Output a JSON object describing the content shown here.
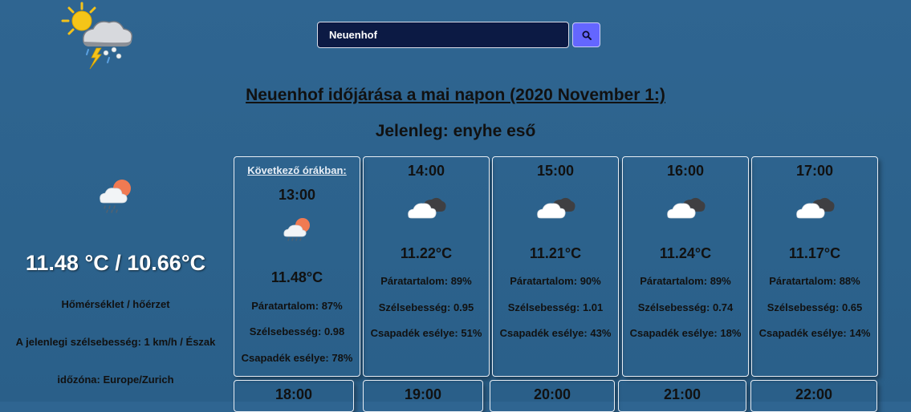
{
  "search": {
    "value": "Neuenhof",
    "button_icon": "search-icon"
  },
  "title": "Neuenhof időjárása a mai napon (2020 November 1:)",
  "current_condition": "Jelenleg: enyhe eső",
  "current": {
    "temp": "11.48 °C / 10.66°C",
    "temp_caption": "Hőmérséklet / hőérzet",
    "wind": "A jelenlegi szélsebesség: 1 km/h / Észak",
    "timezone": "időzóna: Europe/Zurich"
  },
  "labels": {
    "next_hours": "Következő órákban:",
    "humidity": "Páratartalom:",
    "wind": "Szélsebesség:",
    "precip": "Csapadék esélye:"
  },
  "hours": [
    {
      "time": "13:00",
      "temp": "11.48°C",
      "humidity": "87%",
      "wind": "0.98",
      "precip": "78%",
      "icon": "sun-cloud-rain-icon"
    },
    {
      "time": "14:00",
      "temp": "11.22°C",
      "humidity": "89%",
      "wind": "0.95",
      "precip": "51%",
      "icon": "cloud-icon"
    },
    {
      "time": "15:00",
      "temp": "11.21°C",
      "humidity": "90%",
      "wind": "1.01",
      "precip": "43%",
      "icon": "cloud-icon"
    },
    {
      "time": "16:00",
      "temp": "11.24°C",
      "humidity": "89%",
      "wind": "0.74",
      "precip": "18%",
      "icon": "cloud-icon"
    },
    {
      "time": "17:00",
      "temp": "11.17°C",
      "humidity": "88%",
      "wind": "0.65",
      "precip": "14%",
      "icon": "cloud-icon"
    }
  ],
  "next_row_times": [
    "18:00",
    "19:00",
    "20:00",
    "21:00",
    "22:00"
  ],
  "colors": {
    "search_button": "#6466ff",
    "search_input_bg": "#0c1a44",
    "background": "#2f6591"
  }
}
